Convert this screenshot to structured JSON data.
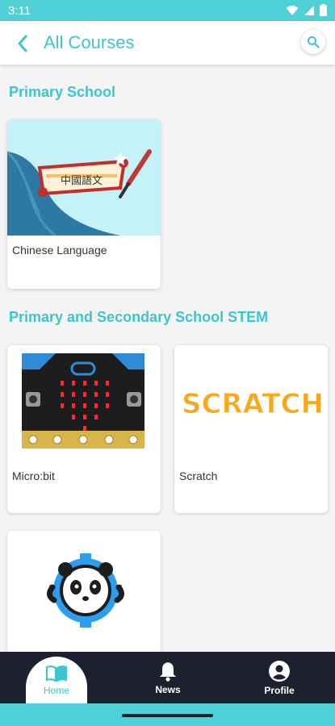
{
  "status": {
    "time": "3:11"
  },
  "app_bar": {
    "title": "All Courses"
  },
  "sections": [
    {
      "title": "Primary School"
    },
    {
      "title": "Primary and Secondary School STEM"
    }
  ],
  "courses": [
    {
      "label": "Chinese Language",
      "image_text": "中國語文"
    },
    {
      "label": "Micro:bit"
    },
    {
      "label": "Scratch",
      "image_text": "SCRATCH"
    },
    {
      "label": ""
    }
  ],
  "nav": [
    {
      "label": "Home",
      "icon": "book-icon"
    },
    {
      "label": "News",
      "icon": "bell-icon"
    },
    {
      "label": "Profile",
      "icon": "account-icon"
    }
  ],
  "colors": {
    "accent": "#3cc5cf",
    "status_bar": "#4fcfd6",
    "nav_bg": "#1e2030",
    "scratch_orange": "#f7a81b"
  }
}
